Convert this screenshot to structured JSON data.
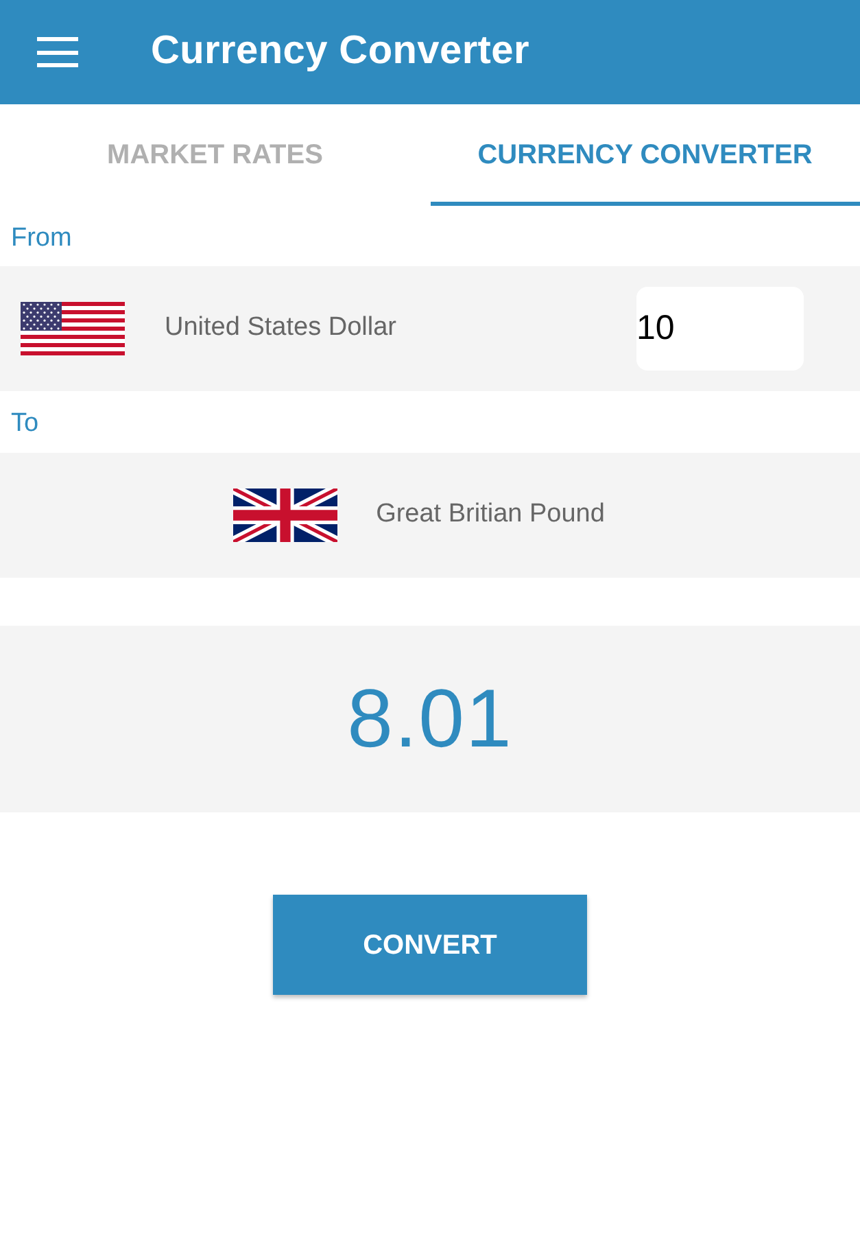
{
  "app_bar": {
    "title": "Currency Converter"
  },
  "tabs": [
    {
      "label": "MARKET RATES",
      "selected": false
    },
    {
      "label": "CURRENCY CONVERTER",
      "selected": true
    }
  ],
  "from": {
    "label": "From",
    "currency": "United States Dollar",
    "amount": "10"
  },
  "to": {
    "label": "To",
    "currency": "Great Britian Pound"
  },
  "result": {
    "value": "8.01"
  },
  "convert_button": {
    "label": "CONVERT"
  }
}
